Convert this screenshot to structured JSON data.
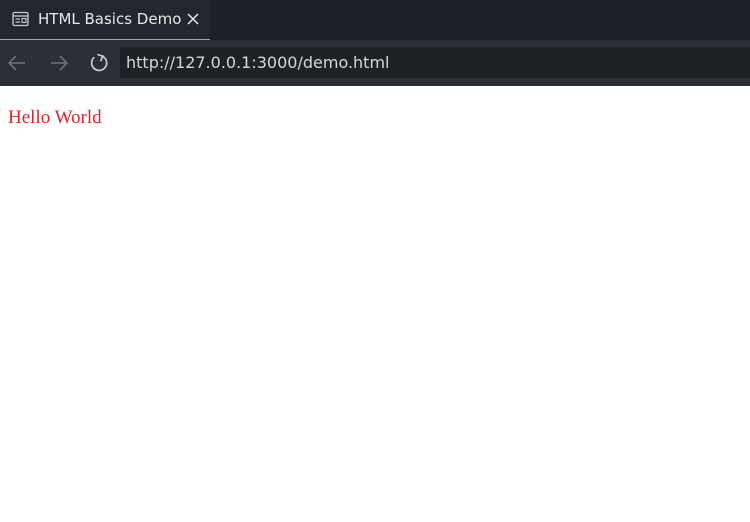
{
  "browser": {
    "tab": {
      "title": "HTML Basics Demo",
      "icon": "preview-page-icon",
      "close_icon": "close-icon"
    },
    "toolbar": {
      "back_icon": "arrow-left-icon",
      "forward_icon": "arrow-right-icon",
      "reload_icon": "reload-icon",
      "url": "http://127.0.0.1:3000/demo.html"
    },
    "colors": {
      "tab_strip": "#1d2127",
      "toolbar": "#2b2f36",
      "url_bar": "#1e2227",
      "url_text": "#d3d7dc"
    }
  },
  "page": {
    "text": "Hello World",
    "text_color": "#e0242c",
    "background": "#ffffff"
  }
}
